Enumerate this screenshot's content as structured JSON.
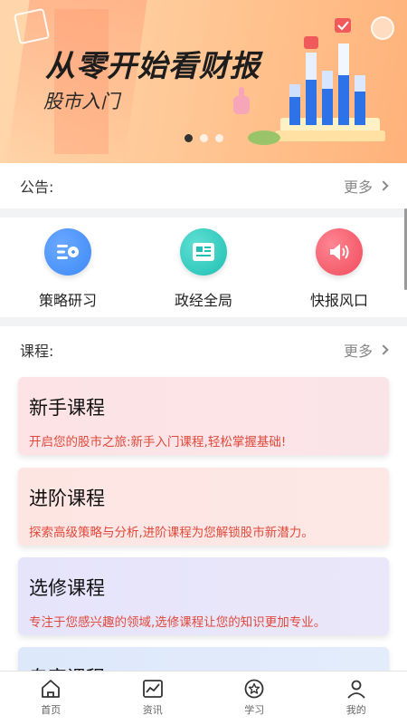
{
  "banner": {
    "title": "从零开始看财报",
    "subtitle": "股市入门",
    "slides": 3,
    "active_slide": 1
  },
  "notice": {
    "label": "公告:",
    "more": "更多"
  },
  "quick_entries": [
    {
      "label": "策略研习",
      "icon": "strategy-icon",
      "color": "#3d8af7"
    },
    {
      "label": "政经全局",
      "icon": "newspaper-icon",
      "color": "#1fbfb3"
    },
    {
      "label": "快报风口",
      "icon": "speaker-icon",
      "color": "#f04b5a"
    }
  ],
  "courses": {
    "label": "课程:",
    "more": "更多",
    "items": [
      {
        "title": "新手课程",
        "desc": "开启您的股市之旅:新手入门课程,轻松掌握基础!",
        "bg": "#fde3e6"
      },
      {
        "title": "进阶课程",
        "desc": "探索高级策略与分析,进阶课程为您解锁股市新潜力。",
        "bg": "#fde5e2"
      },
      {
        "title": "选修课程",
        "desc": "专注于您感兴趣的领域,选修课程让您的知识更加专业。",
        "bg": "#e6e4fb"
      },
      {
        "title": "专家课程",
        "desc": "",
        "bg": "#dde8fb"
      }
    ]
  },
  "tabbar": [
    {
      "label": "首页",
      "icon": "home-icon"
    },
    {
      "label": "资讯",
      "icon": "chart-icon"
    },
    {
      "label": "学习",
      "icon": "star-badge-icon"
    },
    {
      "label": "我的",
      "icon": "user-icon"
    }
  ]
}
